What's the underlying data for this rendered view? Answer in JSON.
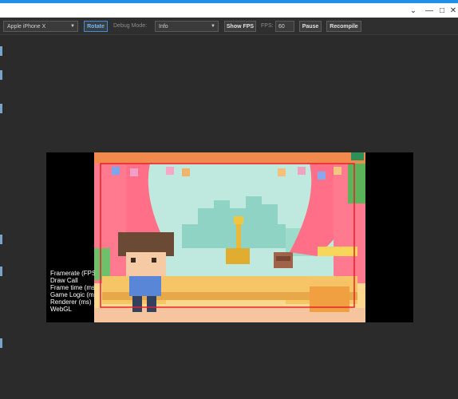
{
  "window": {
    "minimize_glyph": "‹",
    "minimize_glyph_alt": "—",
    "maximize_glyph": "□",
    "close_glyph": "✕"
  },
  "toolbar": {
    "device_select": "Apple iPhone X",
    "rotate_label": "Rotate",
    "debug_mode_label": "Debug Mode:",
    "debug_mode_value": "Info",
    "show_fps_label": "Show FPS",
    "fps_label": "FPS:",
    "fps_value": "60",
    "pause_label": "Pause",
    "recompile_label": "Recompile"
  },
  "stats": {
    "lines": [
      "Framerate (FPS)",
      "Draw Call",
      "Frame time (ms)",
      "Game Logic (ms)",
      "Renderer (ms)",
      "WebGL"
    ]
  },
  "colors": {
    "accent": "#1e90e6",
    "selection_outline": "#e8202a"
  }
}
